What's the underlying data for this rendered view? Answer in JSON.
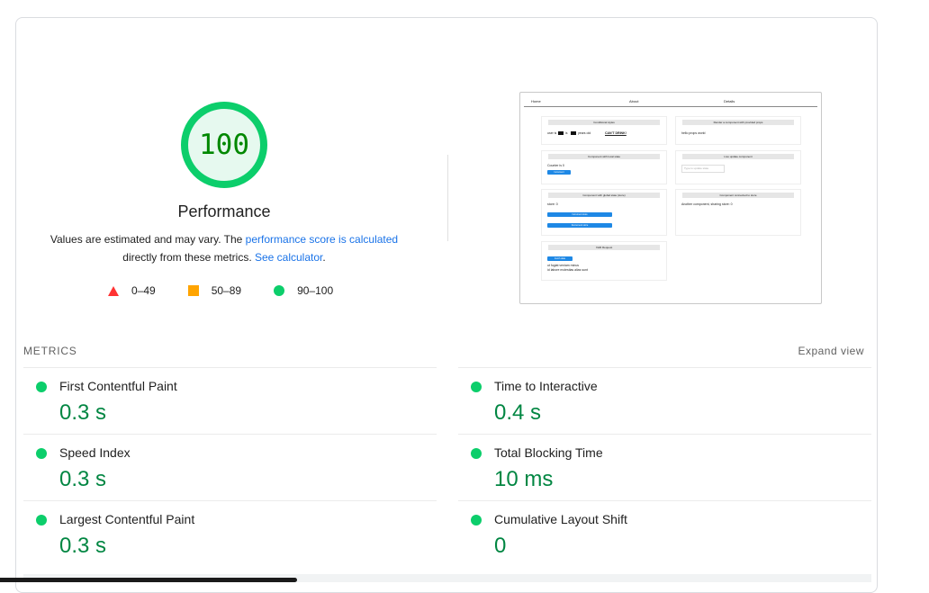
{
  "gauge": {
    "score": "100",
    "score_fraction": 1.0,
    "title": "Performance",
    "desc_prefix": "Values are estimated and may vary. The ",
    "desc_link": "performance score is calculated",
    "desc_middle": " directly from these metrics. ",
    "desc_calc_link": "See calculator",
    "desc_suffix": ".",
    "color": "#0cce6b"
  },
  "legend": {
    "fail": "0–49",
    "average": "50–89",
    "pass": "90–100",
    "colors": {
      "fail": "#ff3333",
      "average": "#ffa400",
      "pass": "#0cce6b"
    }
  },
  "thumbnail": {
    "nav": [
      "Home",
      "About",
      "Details"
    ],
    "boxes": [
      {
        "header": "Conditional styles",
        "lines": [
          "user is",
          "is",
          "years old",
          "CAN'T DRINK!"
        ]
      },
      {
        "header": "Render a component with provided props",
        "lines": [
          "hello props world"
        ]
      },
      {
        "header": "Component with local state",
        "lines": [
          "Counter is 0"
        ],
        "button": "Increment"
      },
      {
        "header": "Live update component",
        "input_placeholder": "Type to update state"
      },
      {
        "header": "Component with global state (store)",
        "lines": [
          "store: 0"
        ],
        "buttons": [
          "Increment store",
          "Decrement store"
        ]
      },
      {
        "header": "Component connected to store",
        "lines": [
          "Another component, sharing store: 0"
        ]
      },
      {
        "header": "XHR Request",
        "button": "Fetch data",
        "lines": [
          "ut fugiat veniam minus",
          "id labore molestias alias sunt"
        ]
      }
    ]
  },
  "metrics": {
    "title": "METRICS",
    "expand": "Expand view",
    "items": [
      {
        "label": "First Contentful Paint",
        "value": "0.3 s"
      },
      {
        "label": "Time to Interactive",
        "value": "0.4 s"
      },
      {
        "label": "Speed Index",
        "value": "0.3 s"
      },
      {
        "label": "Total Blocking Time",
        "value": "10 ms"
      },
      {
        "label": "Largest Contentful Paint",
        "value": "0.3 s"
      },
      {
        "label": "Cumulative Layout Shift",
        "value": "0"
      }
    ],
    "status_color": "#0cce6b",
    "value_color": "#018642"
  }
}
